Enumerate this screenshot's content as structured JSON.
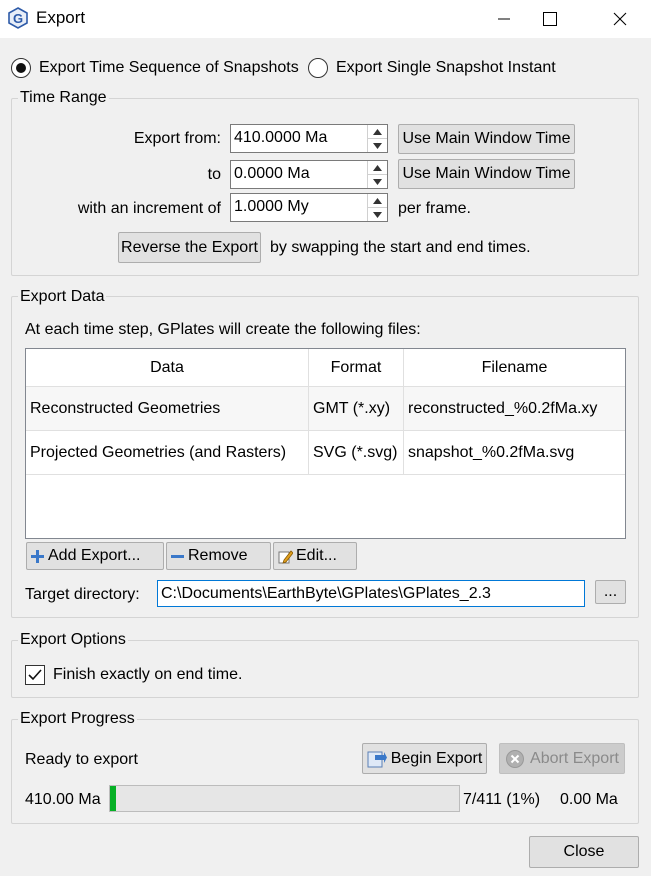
{
  "window": {
    "title": "Export",
    "app_icon": "gplates-g-icon"
  },
  "mode": {
    "sequence_label": "Export Time Sequence of Snapshots",
    "single_label": "Export Single Snapshot Instant",
    "selected": "sequence"
  },
  "time_range": {
    "title": "Time Range",
    "from_label": "Export from:",
    "from_value": "410.0000 Ma",
    "to_label": "to",
    "to_value": "0.0000 Ma",
    "increment_label": "with an increment of",
    "increment_value": "1.0000 My",
    "per_frame": "per frame.",
    "use_main_window_time": "Use Main Window Time",
    "reverse_button": "Reverse the Export",
    "reverse_desc": "by swapping the start and end times."
  },
  "export_data": {
    "title": "Export Data",
    "description": "At each time step, GPlates will create the following files:",
    "columns": [
      "Data",
      "Format",
      "Filename"
    ],
    "rows": [
      {
        "data": "Reconstructed Geometries",
        "format": "GMT (*.xy)",
        "filename": "reconstructed_%0.2fMa.xy"
      },
      {
        "data": "Projected Geometries (and Rasters)",
        "format": "SVG (*.svg)",
        "filename": "snapshot_%0.2fMa.svg"
      }
    ],
    "add_button": "Add Export...",
    "remove_button": "Remove",
    "edit_button": "Edit...",
    "target_label": "Target directory:",
    "target_value": "C:\\Documents\\EarthByte\\GPlates\\GPlates_2.3",
    "browse_button": "..."
  },
  "export_options": {
    "title": "Export Options",
    "finish_label": "Finish exactly on end time.",
    "finish_checked": true
  },
  "export_progress": {
    "title": "Export Progress",
    "status": "Ready to export",
    "begin_button": "Begin Export",
    "abort_button": "Abort Export",
    "start_time": "410.00 Ma",
    "progress_text": "7/411 (1%)",
    "end_time": "0.00 Ma",
    "progress_fraction": 0.017
  },
  "close_button": "Close",
  "colors": {
    "accent": "#0078d7",
    "progress": "#06b025",
    "background": "#f0f0f0"
  }
}
